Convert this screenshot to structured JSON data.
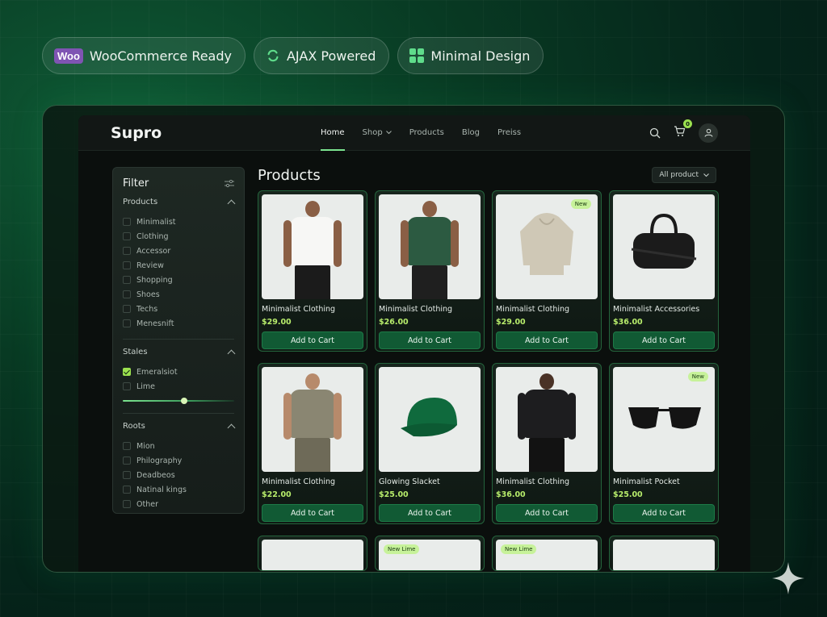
{
  "badges": [
    {
      "icon": "woo-logo",
      "logo_text": "Woo",
      "label": "WooCommerce Ready"
    },
    {
      "icon": "ajax-refresh-icon",
      "label": "AJAX Powered"
    },
    {
      "icon": "grid-icon",
      "label": "Minimal Design"
    }
  ],
  "nav": {
    "logo": "Supro",
    "items": [
      "Home",
      "Shop",
      "Products",
      "Blog",
      "Preiss"
    ],
    "active": "Home",
    "cart_count": "0"
  },
  "filter": {
    "title": "Filter",
    "sections": [
      {
        "title": "Products",
        "options": [
          "Minimalist",
          "Clothing",
          "Accessor",
          "Review",
          "Shopping",
          "Shoes",
          "Techs",
          "Menesnift"
        ]
      },
      {
        "title": "Stales",
        "options": [
          "Emeralsiot",
          "Lime"
        ],
        "checked": "Emeralsiot",
        "slider_value": 0.55
      },
      {
        "title": "Roots",
        "options": [
          "Mion",
          "Philography",
          "Deadbeos",
          "Natinal kings",
          "Other"
        ]
      }
    ]
  },
  "main": {
    "title": "Products",
    "sort_label": "All product"
  },
  "products": [
    {
      "name": "Minimalist Clothing",
      "price": "$29.00",
      "cta": "Add to Cart",
      "tag": "",
      "kind": "tee-white"
    },
    {
      "name": "Minimalist Clothing",
      "price": "$26.00",
      "cta": "Add to Cart",
      "tag": "",
      "kind": "tee-green"
    },
    {
      "name": "Minimalist Clothing",
      "price": "$29.00",
      "cta": "Add to Cart",
      "tag": "New",
      "kind": "hoodie-beige"
    },
    {
      "name": "Minimalist Accessories",
      "price": "$36.00",
      "cta": "Add to Cart",
      "tag": "",
      "kind": "bag"
    },
    {
      "name": "Minimalist Clothing",
      "price": "$22.00",
      "cta": "Add to Cart",
      "tag": "",
      "kind": "tee-olive"
    },
    {
      "name": "Glowing Slacket",
      "price": "$25.00",
      "cta": "Add to Cart",
      "tag": "",
      "kind": "cap"
    },
    {
      "name": "Minimalist Clothing",
      "price": "$36.00",
      "cta": "Add to Cart",
      "tag": "",
      "kind": "hoodie-black"
    },
    {
      "name": "Minimalist Pocket",
      "price": "$25.00",
      "cta": "Add to Cart",
      "tag": "New",
      "kind": "sunglasses"
    }
  ],
  "partial_row_tags": [
    "",
    "New Lime",
    "New Lime",
    ""
  ],
  "colors": {
    "accent": "#9be04f",
    "button": "#115a34",
    "price": "#b7ec6b"
  }
}
